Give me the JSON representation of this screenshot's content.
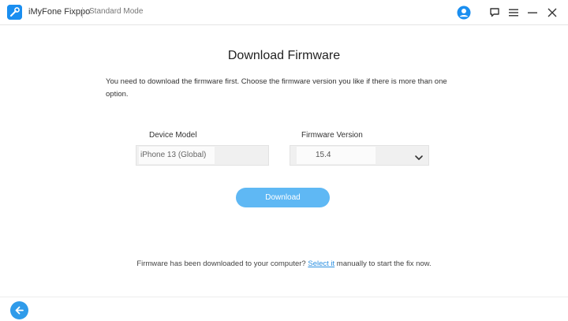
{
  "app": {
    "name": "iMyFone Fixppo",
    "mode": "Standard Mode",
    "logo_icon": "fixppo-wrench-icon",
    "accent_color": "#1a8ef0"
  },
  "titlebar_icons": {
    "avatar": "user-avatar-icon",
    "feedback": "feedback-icon",
    "menu": "hamburger-menu-icon",
    "minimize": "minimize-icon",
    "close": "close-icon"
  },
  "main": {
    "title": "Download Firmware",
    "instructions": "You need to download the firmware first. Choose the firmware version you like if there is more than one option.",
    "device_model": {
      "label": "Device Model",
      "value": "iPhone 13 (Global)"
    },
    "firmware_version": {
      "label": "Firmware Version",
      "selected": "15.4",
      "icon": "chevron-down-icon"
    },
    "download_button": {
      "label": "Download",
      "color": "#5fb8f4"
    }
  },
  "footer": {
    "text_before": "Firmware has been downloaded to your computer?",
    "link_text": "Select it",
    "text_after": "manually to start the fix now.",
    "link_color": "#2b8fe0"
  },
  "bottom": {
    "back_icon": "back-arrow-icon",
    "back_color": "#2f9bea"
  }
}
